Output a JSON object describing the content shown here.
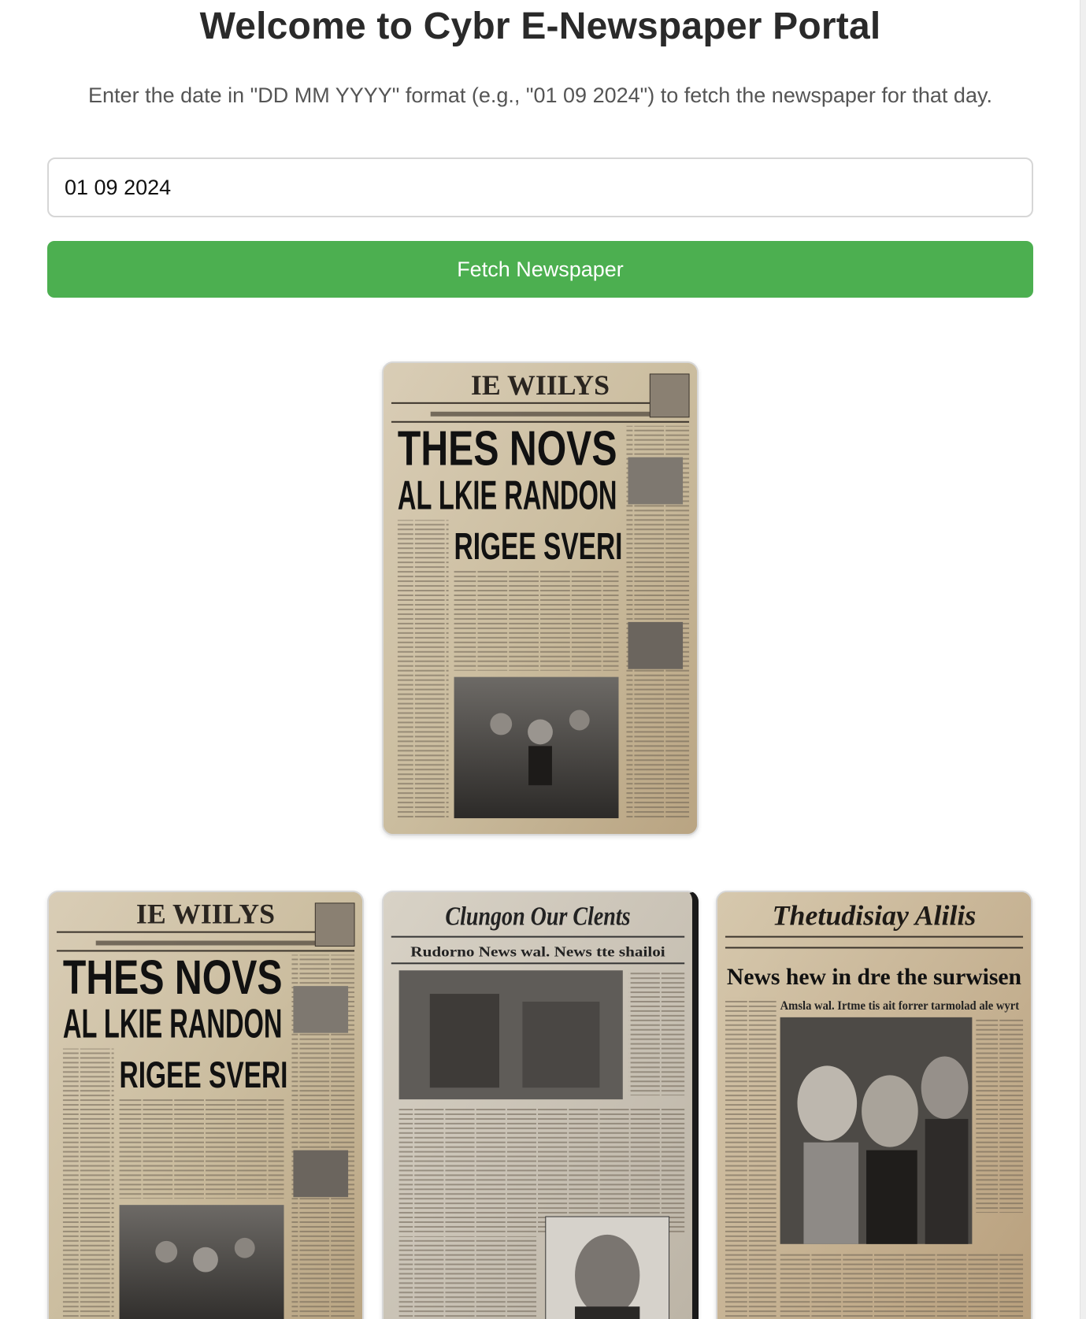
{
  "header": {
    "title": "Welcome to Cybr E-Newspaper Portal",
    "subtitle": "Enter the date in \"DD MM YYYY\" format (e.g., \"01 09 2024\") to fetch the newspaper for that day."
  },
  "form": {
    "date_value": "01 09 2024",
    "fetch_label": "Fetch Newspaper",
    "button_color": "#4caf50"
  },
  "newspapers": {
    "featured": {
      "masthead": "IE WIILYS",
      "headline_1": "THES NOVS",
      "headline_2": "AL LKIE RANDON",
      "headline_3": "RIGEE SVERI"
    },
    "grid": [
      {
        "masthead": "IE WIILYS",
        "headline_1": "THES NOVS",
        "headline_2": "AL LKIE RANDON",
        "headline_3": "RIGEE SVERI"
      },
      {
        "masthead": "Clungon Our Clents",
        "headline_1": "Rudorno News wal. News tte shailoi"
      },
      {
        "masthead": "Thetudisiay Alilis",
        "headline_1": "News hew in dre the surwisen",
        "headline_2": "Amsla wal. Irtme tis ait forrer tarmolad ale wyrt"
      }
    ]
  }
}
